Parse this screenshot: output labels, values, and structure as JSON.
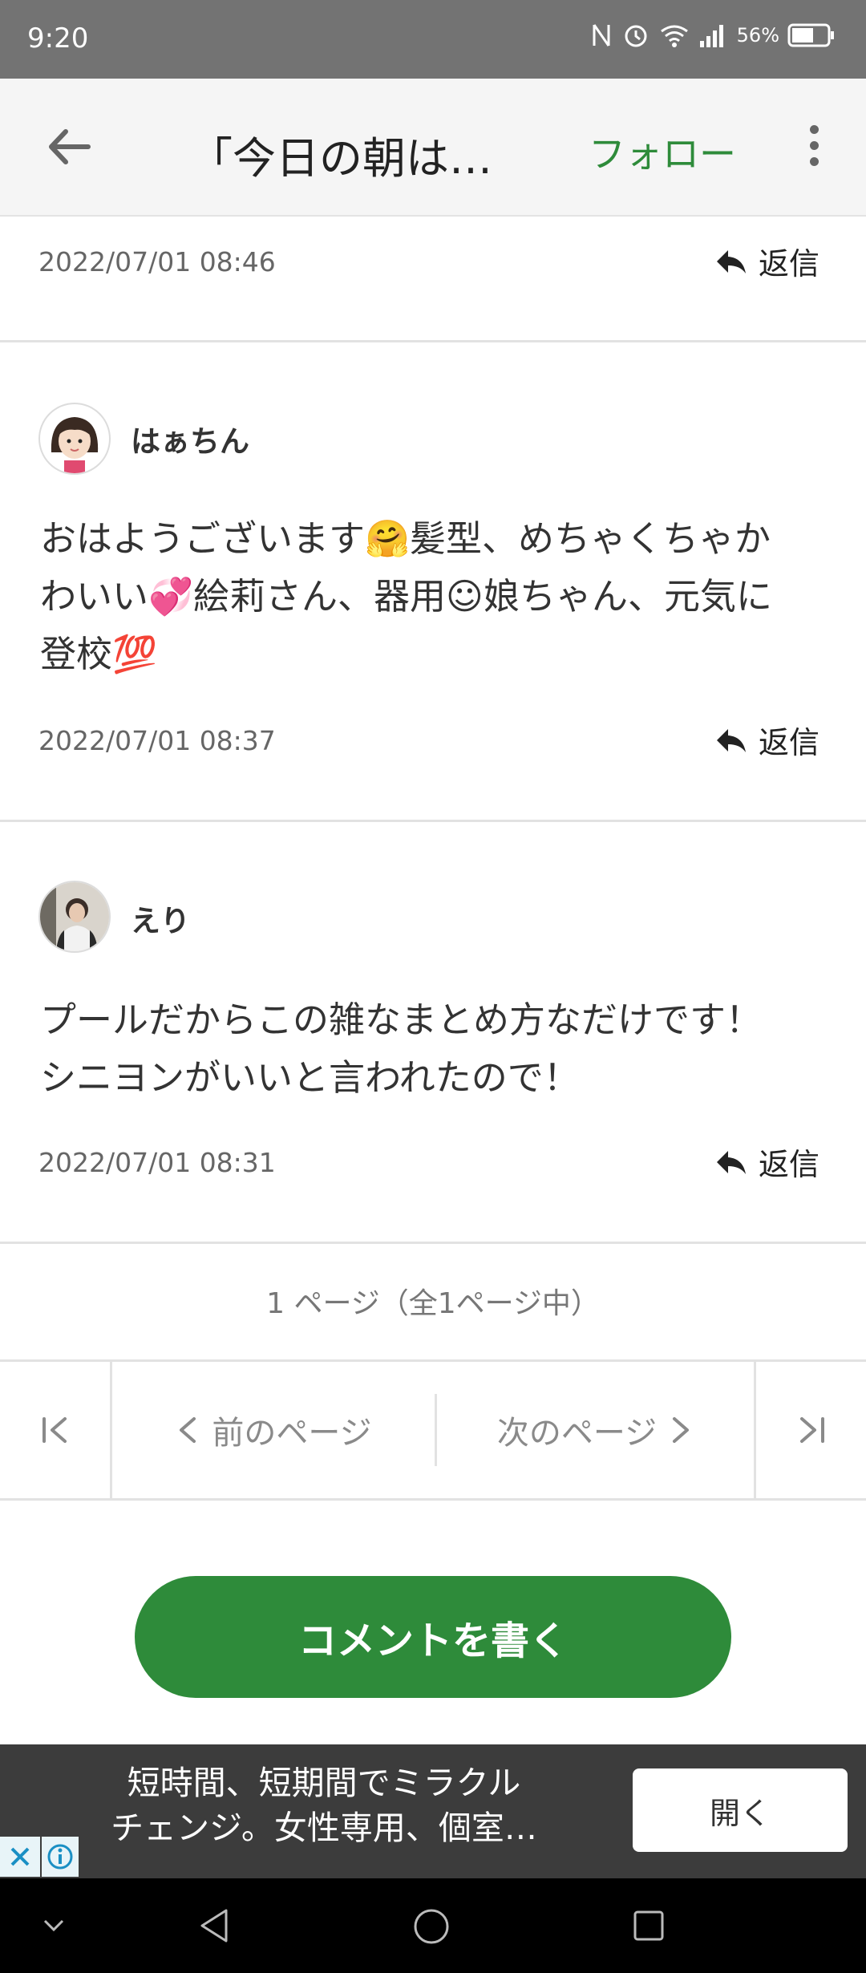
{
  "status_bar": {
    "time": "9:20",
    "battery": "56%"
  },
  "header": {
    "title": "「今日の朝は…",
    "follow": "フォロー"
  },
  "comments": [
    {
      "timestamp": "2022/07/01 08:46",
      "reply": "返信"
    },
    {
      "username": "はぁちん",
      "body_line1": "おはようございます🤗髪型、めちゃくちゃか",
      "body_line2": "わいい💞絵莉さん、器用☺娘ちゃん、元気に",
      "body_line3": "登校💯",
      "timestamp": "2022/07/01 08:37",
      "reply": "返信"
    },
    {
      "username": "えり",
      "body_line1": "プールだからこの雑なまとめ方なだけです！",
      "body_line2": "シニヨンがいいと言われたので！",
      "timestamp": "2022/07/01 08:31",
      "reply": "返信"
    }
  ],
  "pager": {
    "info": "1 ページ（全1ページ中）",
    "prev": "前のページ",
    "next": "次のページ"
  },
  "write_comment": "コメントを書く",
  "ad": {
    "line1": "短時間、短期間でミラクル",
    "line2": "チェンジ。女性専用、個室…",
    "open": "開く"
  },
  "colors": {
    "accent": "#2e8b3a",
    "status_bar": "#737373",
    "ad_bg": "#3c3c3c"
  }
}
